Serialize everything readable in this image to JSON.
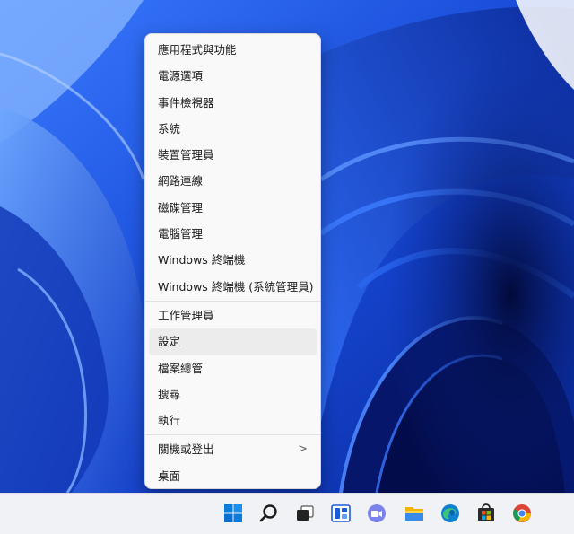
{
  "context_menu": {
    "groups": [
      [
        {
          "label": "應用程式與功能"
        },
        {
          "label": "電源選項"
        },
        {
          "label": "事件檢視器"
        },
        {
          "label": "系統"
        },
        {
          "label": "裝置管理員"
        },
        {
          "label": "網路連線"
        },
        {
          "label": "磁碟管理"
        },
        {
          "label": "電腦管理"
        },
        {
          "label": "Windows 終端機"
        },
        {
          "label": "Windows 終端機 (系統管理員)"
        }
      ],
      [
        {
          "label": "工作管理員"
        },
        {
          "label": "設定"
        },
        {
          "label": "檔案總管"
        },
        {
          "label": "搜尋"
        },
        {
          "label": "執行"
        }
      ],
      [
        {
          "label": "關機或登出",
          "submenu_indicator": ">"
        },
        {
          "label": "桌面"
        }
      ]
    ],
    "hovered_item": "設定"
  },
  "taskbar": {
    "icons": [
      "start-icon",
      "search-icon",
      "task-view-icon",
      "widgets-icon",
      "teams-chat-icon",
      "file-explorer-icon",
      "edge-icon",
      "store-icon",
      "chrome-icon"
    ]
  },
  "colors": {
    "wallpaper_base": "#1a4fd8",
    "menu_background": "#f9f9f9",
    "hover_background": "#ececec",
    "taskbar_background": "#f0f2f5"
  }
}
